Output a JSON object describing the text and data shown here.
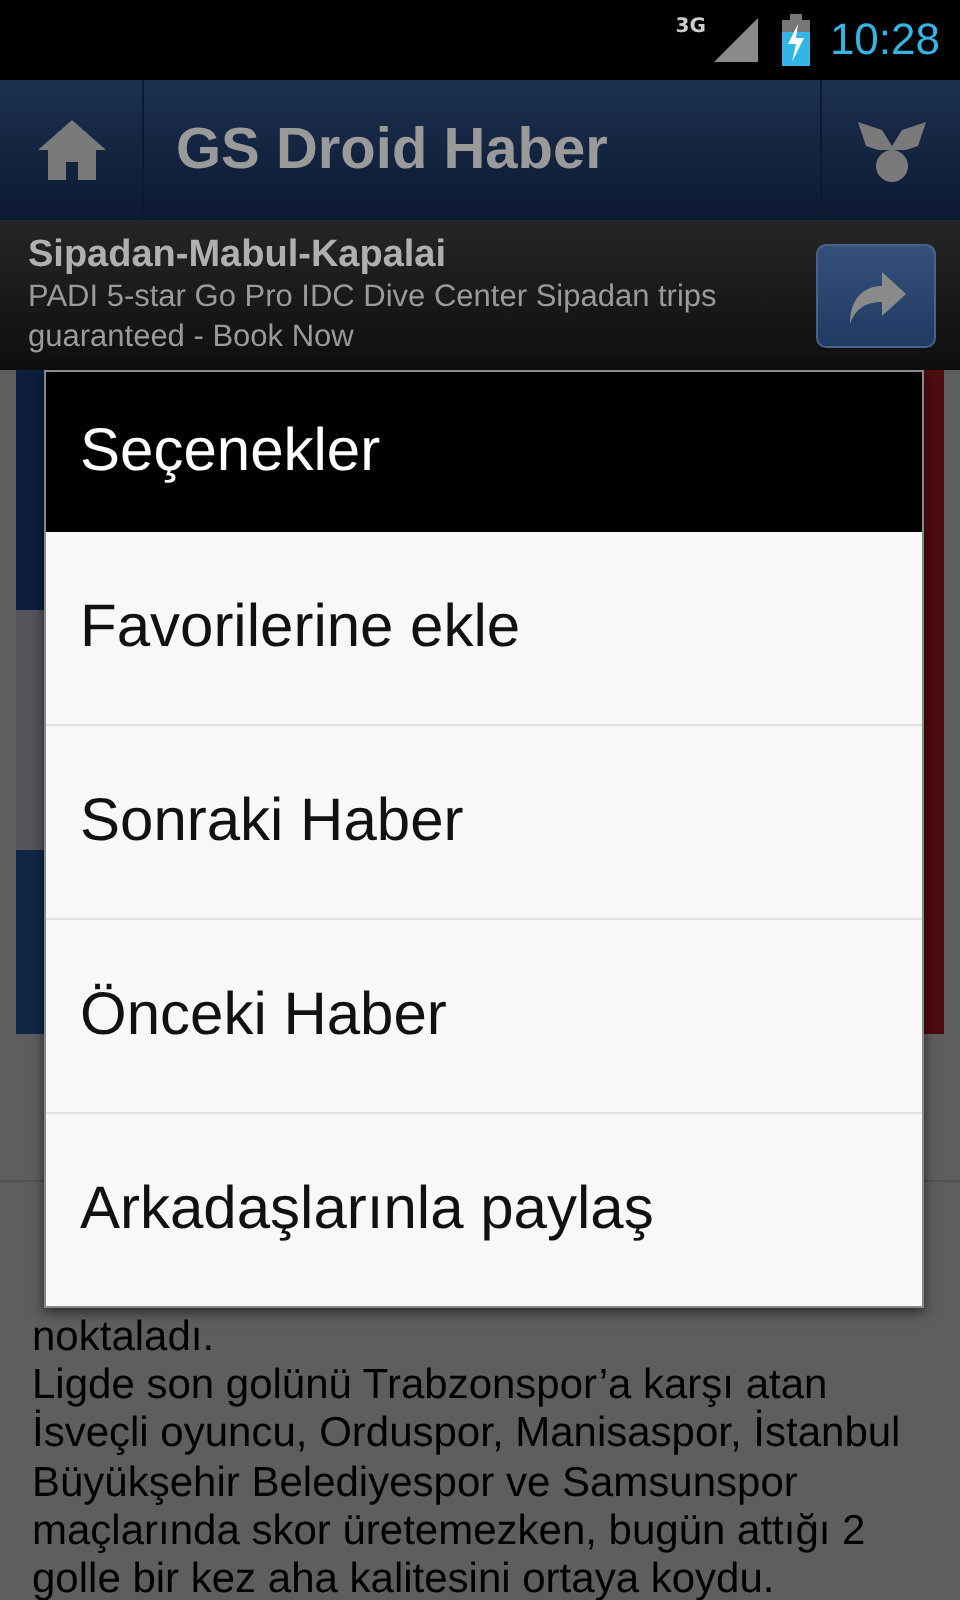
{
  "status_bar": {
    "network": "3G",
    "time": "10:28"
  },
  "action_bar": {
    "title": "GS Droid Haber"
  },
  "ad": {
    "title": "Sipadan-Mabul-Kapalai",
    "text": "PADI 5-star Go Pro IDC Dive Center Sipadan trips guaranteed - Book Now"
  },
  "article": {
    "paragraphs": [
      "noktaladı.",
      "Ligde son golünü Trabzonspor’a karşı atan İsveçli oyuncu, Orduspor, Manisaspor, İstanbul Büyükşehir Belediyespor ve Samsunspor maçlarında skor üretemezken, bugün attığı 2 golle bir kez aha kalitesini ortaya koydu."
    ]
  },
  "dialog": {
    "title": "Seçenekler",
    "items": [
      {
        "label": "Favorilerine ekle"
      },
      {
        "label": "Sonraki Haber"
      },
      {
        "label": "Önceki Haber"
      },
      {
        "label": "Arkadaşlarınla paylaş"
      }
    ]
  }
}
